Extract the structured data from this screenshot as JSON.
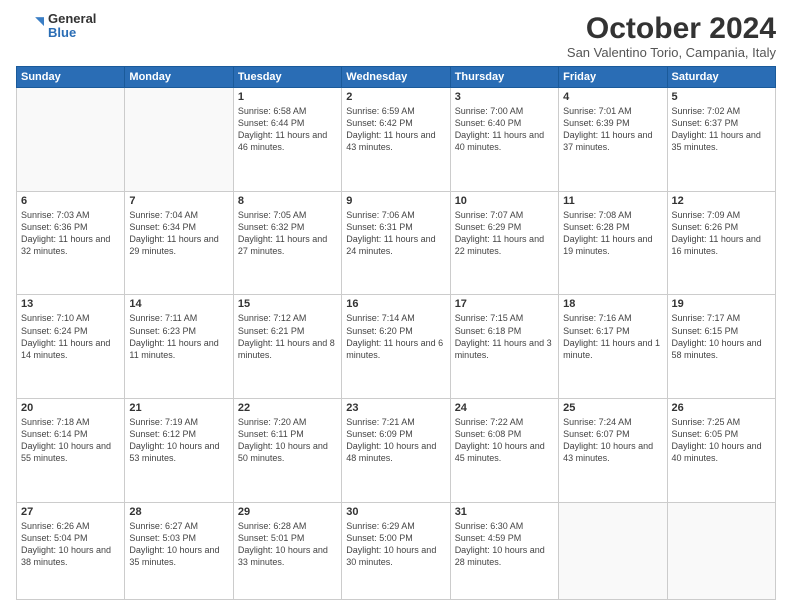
{
  "logo": {
    "general": "General",
    "blue": "Blue"
  },
  "header": {
    "month": "October 2024",
    "location": "San Valentino Torio, Campania, Italy"
  },
  "weekdays": [
    "Sunday",
    "Monday",
    "Tuesday",
    "Wednesday",
    "Thursday",
    "Friday",
    "Saturday"
  ],
  "weeks": [
    [
      {
        "day": "",
        "info": ""
      },
      {
        "day": "",
        "info": ""
      },
      {
        "day": "1",
        "info": "Sunrise: 6:58 AM\nSunset: 6:44 PM\nDaylight: 11 hours and 46 minutes."
      },
      {
        "day": "2",
        "info": "Sunrise: 6:59 AM\nSunset: 6:42 PM\nDaylight: 11 hours and 43 minutes."
      },
      {
        "day": "3",
        "info": "Sunrise: 7:00 AM\nSunset: 6:40 PM\nDaylight: 11 hours and 40 minutes."
      },
      {
        "day": "4",
        "info": "Sunrise: 7:01 AM\nSunset: 6:39 PM\nDaylight: 11 hours and 37 minutes."
      },
      {
        "day": "5",
        "info": "Sunrise: 7:02 AM\nSunset: 6:37 PM\nDaylight: 11 hours and 35 minutes."
      }
    ],
    [
      {
        "day": "6",
        "info": "Sunrise: 7:03 AM\nSunset: 6:36 PM\nDaylight: 11 hours and 32 minutes."
      },
      {
        "day": "7",
        "info": "Sunrise: 7:04 AM\nSunset: 6:34 PM\nDaylight: 11 hours and 29 minutes."
      },
      {
        "day": "8",
        "info": "Sunrise: 7:05 AM\nSunset: 6:32 PM\nDaylight: 11 hours and 27 minutes."
      },
      {
        "day": "9",
        "info": "Sunrise: 7:06 AM\nSunset: 6:31 PM\nDaylight: 11 hours and 24 minutes."
      },
      {
        "day": "10",
        "info": "Sunrise: 7:07 AM\nSunset: 6:29 PM\nDaylight: 11 hours and 22 minutes."
      },
      {
        "day": "11",
        "info": "Sunrise: 7:08 AM\nSunset: 6:28 PM\nDaylight: 11 hours and 19 minutes."
      },
      {
        "day": "12",
        "info": "Sunrise: 7:09 AM\nSunset: 6:26 PM\nDaylight: 11 hours and 16 minutes."
      }
    ],
    [
      {
        "day": "13",
        "info": "Sunrise: 7:10 AM\nSunset: 6:24 PM\nDaylight: 11 hours and 14 minutes."
      },
      {
        "day": "14",
        "info": "Sunrise: 7:11 AM\nSunset: 6:23 PM\nDaylight: 11 hours and 11 minutes."
      },
      {
        "day": "15",
        "info": "Sunrise: 7:12 AM\nSunset: 6:21 PM\nDaylight: 11 hours and 8 minutes."
      },
      {
        "day": "16",
        "info": "Sunrise: 7:14 AM\nSunset: 6:20 PM\nDaylight: 11 hours and 6 minutes."
      },
      {
        "day": "17",
        "info": "Sunrise: 7:15 AM\nSunset: 6:18 PM\nDaylight: 11 hours and 3 minutes."
      },
      {
        "day": "18",
        "info": "Sunrise: 7:16 AM\nSunset: 6:17 PM\nDaylight: 11 hours and 1 minute."
      },
      {
        "day": "19",
        "info": "Sunrise: 7:17 AM\nSunset: 6:15 PM\nDaylight: 10 hours and 58 minutes."
      }
    ],
    [
      {
        "day": "20",
        "info": "Sunrise: 7:18 AM\nSunset: 6:14 PM\nDaylight: 10 hours and 55 minutes."
      },
      {
        "day": "21",
        "info": "Sunrise: 7:19 AM\nSunset: 6:12 PM\nDaylight: 10 hours and 53 minutes."
      },
      {
        "day": "22",
        "info": "Sunrise: 7:20 AM\nSunset: 6:11 PM\nDaylight: 10 hours and 50 minutes."
      },
      {
        "day": "23",
        "info": "Sunrise: 7:21 AM\nSunset: 6:09 PM\nDaylight: 10 hours and 48 minutes."
      },
      {
        "day": "24",
        "info": "Sunrise: 7:22 AM\nSunset: 6:08 PM\nDaylight: 10 hours and 45 minutes."
      },
      {
        "day": "25",
        "info": "Sunrise: 7:24 AM\nSunset: 6:07 PM\nDaylight: 10 hours and 43 minutes."
      },
      {
        "day": "26",
        "info": "Sunrise: 7:25 AM\nSunset: 6:05 PM\nDaylight: 10 hours and 40 minutes."
      }
    ],
    [
      {
        "day": "27",
        "info": "Sunrise: 6:26 AM\nSunset: 5:04 PM\nDaylight: 10 hours and 38 minutes."
      },
      {
        "day": "28",
        "info": "Sunrise: 6:27 AM\nSunset: 5:03 PM\nDaylight: 10 hours and 35 minutes."
      },
      {
        "day": "29",
        "info": "Sunrise: 6:28 AM\nSunset: 5:01 PM\nDaylight: 10 hours and 33 minutes."
      },
      {
        "day": "30",
        "info": "Sunrise: 6:29 AM\nSunset: 5:00 PM\nDaylight: 10 hours and 30 minutes."
      },
      {
        "day": "31",
        "info": "Sunrise: 6:30 AM\nSunset: 4:59 PM\nDaylight: 10 hours and 28 minutes."
      },
      {
        "day": "",
        "info": ""
      },
      {
        "day": "",
        "info": ""
      }
    ]
  ]
}
